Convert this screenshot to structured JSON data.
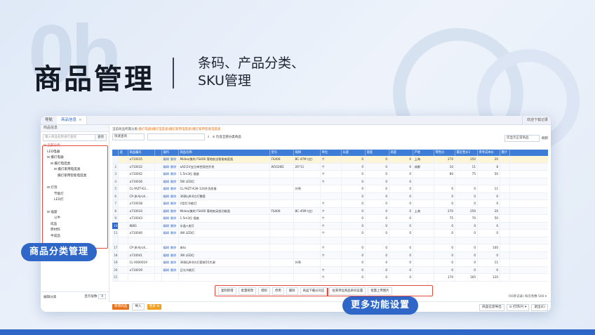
{
  "hero": {
    "deco_text": "0h",
    "title": "商品管理",
    "subtitle_line1": "条码、产品分类、",
    "subtitle_line2": "SKU管理"
  },
  "window": {
    "tabs": [
      {
        "label": "导航"
      },
      {
        "label": "商品信息",
        "close": "×"
      }
    ],
    "user_menu": "欢迎下载记录"
  },
  "sidebar": {
    "header": "商品信息",
    "search_placeholder": "输入商品名称进行查找",
    "search_button": "查找",
    "tree": [
      {
        "label": "⊟ 全部分类",
        "indent": 0,
        "selected": true
      },
      {
        "label": "LED电器",
        "indent": 1
      },
      {
        "label": "⊟ 摄灯电器",
        "indent": 1
      },
      {
        "label": "⊟ 摄灯电度类",
        "indent": 2
      },
      {
        "label": "⊟ 摄灯家用电度类",
        "indent": 3
      },
      {
        "label": "摄灯家用智能电度类",
        "indent": 4
      },
      {
        "label": "",
        "indent": 0
      },
      {
        "label": "⊟ 灯泡",
        "indent": 1
      },
      {
        "label": "节能灯",
        "indent": 3
      },
      {
        "label": "LED灯",
        "indent": 3
      },
      {
        "label": "",
        "indent": 0
      },
      {
        "label": "⊟ 插座",
        "indent": 1
      },
      {
        "label": "公牛",
        "indent": 3
      },
      {
        "label": "成品",
        "indent": 2
      },
      {
        "label": "原材料",
        "indent": 2
      },
      {
        "label": "半成品",
        "indent": 2
      }
    ],
    "footer_left": "编辑分类",
    "footer_right_label": "显示层数",
    "footer_right_value": "4"
  },
  "main": {
    "breadcrumb_label": "当前商品所属分类:",
    "breadcrumb_path": "摄灯电器\\摄灯电度类\\摄灯家用电度类\\摄灯家用智能电度类",
    "filter_select": "快速查询",
    "search_icon": "⌕",
    "include_all": "⊙ 包含全部分类商品",
    "right_select": "仅显示正常商品",
    "refresh": "刷新"
  },
  "table": {
    "columns": [
      "",
      "选",
      "商品编号",
      "",
      "操作",
      "商品名称",
      "型号",
      "规格",
      "单位",
      "长度",
      "宽度",
      "高度",
      "产地",
      "零售价",
      "最近售价1",
      "参考成本价",
      "重计"
    ],
    "rows": [
      {
        "no": "",
        "code": "a710035",
        "name": "Midea/美的 FS406 落地扇全智能电度类",
        "model": "FS406",
        "spec": "BC-47M (红)",
        "unit": "个",
        "l": "0",
        "w": "0",
        "h": "0",
        "origin": "上海",
        "retail": "270",
        "recent": "250",
        "cost": "20",
        "hl": true
      },
      {
        "no": "2",
        "code": "a710032",
        "name": "aA2(1V五位单控双控开关",
        "model": "W1026D",
        "spec": "20*11",
        "unit": "个",
        "l": "0",
        "w": "0",
        "h": "0",
        "origin": "成都",
        "retail": "10",
        "recent": "11",
        "cost": "8"
      },
      {
        "no": "3",
        "code": "a710042",
        "name": "1.5m3位 插座",
        "model": "",
        "spec": "",
        "unit": "个",
        "l": "0",
        "w": "0",
        "h": "0",
        "origin": "",
        "retail": "80",
        "recent": "75",
        "cost": "50"
      },
      {
        "no": "4",
        "code": "a710036",
        "name": "5W LED灯",
        "model": "",
        "spec": "",
        "unit": "个",
        "l": "0",
        "w": "0",
        "h": "0",
        "origin": "",
        "retail": "",
        "recent": "",
        "cost": ""
      },
      {
        "no": "5",
        "code": "CL-YAZT-K3...",
        "name": "CL-YAZT-K36-124升洗发香",
        "model": "",
        "spec": "外壳",
        "unit": "",
        "l": "0",
        "w": "0",
        "h": "0",
        "origin": "",
        "retail": "0",
        "recent": "0",
        "cost": "11"
      },
      {
        "no": "6",
        "code": "CP-JK-AJ-LK...",
        "name": "36款LJK-8方灯整套",
        "model": "",
        "spec": "",
        "unit": "",
        "l": "0",
        "w": "0",
        "h": "0",
        "origin": "",
        "retail": "0",
        "recent": "0",
        "cost": "0"
      },
      {
        "no": "7",
        "code": "a710038",
        "name": "U型灯节能灯",
        "model": "",
        "spec": "",
        "unit": "个",
        "l": "0",
        "w": "0",
        "h": "0",
        "origin": "",
        "retail": "0",
        "recent": "0",
        "cost": "0"
      },
      {
        "no": "8",
        "code": "a710034",
        "name": "Midea/美的 FS406 落地扇无档功能类",
        "model": "FS406",
        "spec": "BC-45M (红)",
        "unit": "个",
        "l": "0",
        "w": "0",
        "h": "0",
        "origin": "上海",
        "retail": "270",
        "recent": "250",
        "cost": "20"
      },
      {
        "no": "9",
        "code": "a710043",
        "name": "1.5m3位 插座",
        "model": "",
        "spec": "",
        "unit": "个",
        "l": "0",
        "w": "0",
        "h": "0",
        "origin": "",
        "retail": "75",
        "recent": "70",
        "cost": "50"
      },
      {
        "no": "10",
        "code": "8881",
        "name": "水晶+皮灯",
        "model": "",
        "spec": "",
        "unit": "个",
        "l": "0",
        "w": "0",
        "h": "0",
        "origin": "",
        "retail": "0",
        "recent": "0",
        "cost": "0",
        "blue": true
      },
      {
        "no": "11",
        "code": "a710040",
        "name": "4W LED灯",
        "model": "",
        "spec": "",
        "unit": "个",
        "l": "0",
        "w": "0",
        "h": "0",
        "origin": "",
        "retail": "0",
        "recent": "0",
        "cost": "0"
      },
      {
        "no": "",
        "code": "",
        "name": "",
        "model": "",
        "spec": "",
        "unit": "",
        "l": "",
        "w": "",
        "h": "",
        "origin": "",
        "retail": "",
        "recent": "",
        "cost": ""
      },
      {
        "no": "17",
        "code": "CP-JK-AJ-LK...",
        "name": "床to",
        "model": "",
        "spec": "",
        "unit": "个",
        "l": "0",
        "w": "0",
        "h": "0",
        "origin": "",
        "retail": "0",
        "recent": "0",
        "cost": "100"
      },
      {
        "no": "18",
        "code": "a710041",
        "name": "3W LED灯",
        "model": "",
        "spec": "",
        "unit": "个",
        "l": "0",
        "w": "0",
        "h": "0",
        "origin": "",
        "retail": "0",
        "recent": "0",
        "cost": "0"
      },
      {
        "no": "19",
        "code": "CL-X000019",
        "name": "36款LJK-8方灯套装55大调",
        "model": "",
        "spec": "外壳",
        "unit": "",
        "l": "0",
        "w": "0",
        "h": "0",
        "origin": "",
        "retail": "0",
        "recent": "0",
        "cost": "11"
      },
      {
        "no": "20",
        "code": "a710039",
        "name": "日光节能灯",
        "model": "",
        "spec": "",
        "unit": "个",
        "l": "0",
        "w": "0",
        "h": "0",
        "origin": "",
        "retail": "0",
        "recent": "0",
        "cost": "0"
      },
      {
        "no": "21",
        "code": "",
        "name": "",
        "model": "",
        "spec": "",
        "unit": "个",
        "l": "0",
        "w": "0",
        "h": "0",
        "origin": "",
        "retail": "170",
        "recent": "165",
        "cost": "120"
      }
    ],
    "op_edit": "编辑",
    "op_delete": "删除"
  },
  "popup_buttons": [
    "复制新增",
    "批量修改",
    "授权",
    "停用",
    "删除",
    "商品下载分对应",
    "往来单位商品条码设置",
    "批量上传图片"
  ],
  "bottombar": {
    "add": "新增商品",
    "import": "导入",
    "more": "更多",
    "more_badge": "⚙",
    "pager": "(56条记录)  每页条数  500 ▾",
    "right_buttons": [
      "商品信息导出",
      "⊙ 打印(P) ▾",
      "退出(E)"
    ]
  },
  "labels": {
    "category": "商品分类管理",
    "more_features": "更多功能设置"
  }
}
